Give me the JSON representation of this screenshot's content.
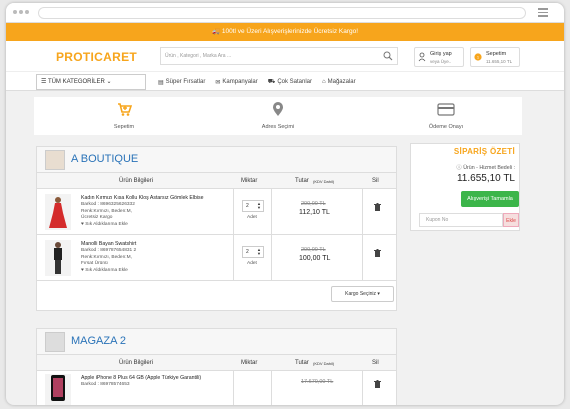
{
  "promo": {
    "text": "100tl ve Üzeri Alışverişlerinizde Ücretsiz Kargo!"
  },
  "header": {
    "logo": "PROTICARET",
    "search_placeholder": "Ürün , Kategori , Marka Ara ...",
    "login_title": "Giriş yap",
    "login_sub": "veya Üye..",
    "cart_title": "Sepetim",
    "cart_sub": "11.655,10 TL",
    "cart_count": "1"
  },
  "nav": {
    "categories": "TÜM KATEGORİLER",
    "links": [
      "Süper Fırsatlar",
      "Kampanyalar",
      "Çok Satanlar",
      "Mağazalar"
    ]
  },
  "steps": [
    "Sepetim",
    "Adres Seçimi",
    "Ödeme Onayı"
  ],
  "table": {
    "col_product": "Ürün Bilgileri",
    "col_qty": "Miktar",
    "col_total": "Tutar",
    "col_total_note": "(KDV Dahil)",
    "col_delete": "Sil"
  },
  "shops": [
    {
      "name": "A BOUTIQUE",
      "items": [
        {
          "title": "Kadın Kırmızı Kısa Kollu Kloş Astarsız Gömlek Elbise",
          "barcode": "Barkod : 8696325626332",
          "variant": "Renk:Kırmızı, Beden:M,",
          "shipping": "Ücretsiz Kargo",
          "fav": "Sık Aldıklarıma Ekle",
          "qty": "2",
          "unit": "Adet",
          "old_price": "200,00 TL",
          "price": "112,10 TL"
        },
        {
          "title": "Manolli Bayan Swatshirt",
          "barcode": "Barkod : 869787654831 2",
          "variant": "Renk:Kırmızı, Beden:M,",
          "shipping": "Fırsat Ürünü",
          "fav": "Sık Aldıklarıma Ekle",
          "qty": "2",
          "unit": "Adet",
          "old_price": "200,00 TL",
          "price": "100,00 TL"
        }
      ],
      "cargo": "Kargo Seçiniz"
    },
    {
      "name": "MAGAZA 2",
      "items": [
        {
          "title": "Apple iPhone 8 Plus 64 GB (Apple Türkiye Garantili)",
          "barcode": "Barkod : 86978574653",
          "old_price": "17.670,00 TL"
        }
      ]
    }
  ],
  "summary": {
    "title": "SİPARİŞ ÖZETİ",
    "subtitle": "Ürün - Hizmet Bedeli :",
    "total": "11.655,10 TL",
    "button": "Alışverişi Tamamla",
    "coupon_placeholder": "Kupon No",
    "coupon_button": "Ekle"
  },
  "colors": {
    "accent": "#f7a51c",
    "link": "#2a73b8",
    "success": "#3cb54a"
  }
}
